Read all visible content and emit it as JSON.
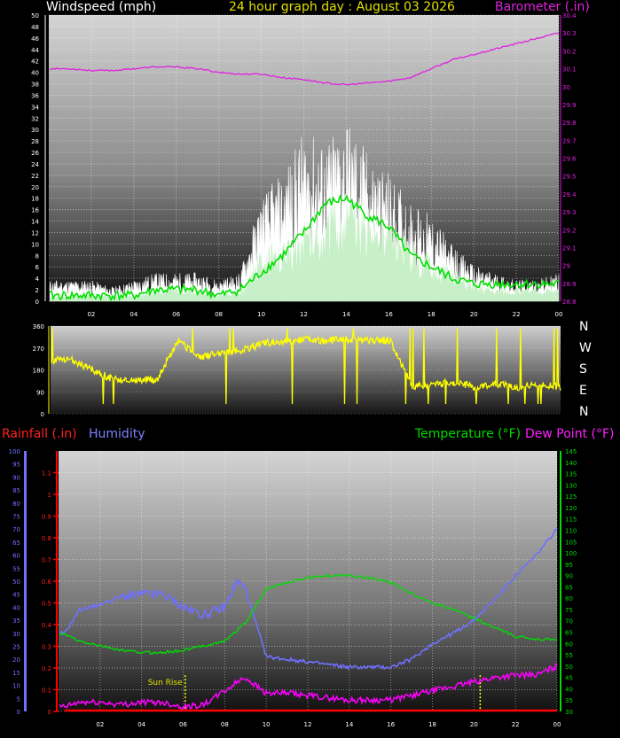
{
  "header": {
    "windspeed_title": "Windspeed (mph)",
    "graph_title": "24 hour graph day : August 03 2026",
    "barometer_title": "Barometer (.in)"
  },
  "lower_legend": {
    "rainfall": "Rainfall (.in)",
    "humidity": "Humidity",
    "temperature": "Temperature (°F)",
    "dew_point": "Dew Point (°F)"
  },
  "compass": [
    "N",
    "W",
    "S",
    "E",
    "N"
  ],
  "sunrise_label": "Sun Rise",
  "colors": {
    "wind_gust": "#ffffff",
    "wind_avg": "#c8f0c8",
    "wind_avg_line": "#00e000",
    "barometer": "#e020e0",
    "direction": "#ffff00",
    "rainfall": "#ff0000",
    "humidity": "#7070ff",
    "temperature": "#00dd00",
    "dew_point": "#ff00ff",
    "hour_marker": "#ffff00"
  },
  "chart_data": [
    {
      "type": "line",
      "panel": "wind-barometer",
      "title": "24 hour graph day : August 03 2026",
      "x_ticks": [
        "02",
        "04",
        "06",
        "08",
        "10",
        "12",
        "14",
        "16",
        "18",
        "20",
        "22",
        "00"
      ],
      "y_left_label": "Windspeed (mph)",
      "y_left_range": [
        0,
        50
      ],
      "y_left_ticks": [
        "0",
        "2",
        "4",
        "6",
        "8",
        "10",
        "12",
        "14",
        "16",
        "18",
        "20",
        "22",
        "24",
        "26",
        "28",
        "30",
        "32",
        "34",
        "36",
        "38",
        "40",
        "42",
        "44",
        "46",
        "48",
        "50"
      ],
      "y_right_label": "Barometer (.in)",
      "y_right_range": [
        28.8,
        30.4
      ],
      "y_right_ticks": [
        "28.8",
        "28.9",
        "29",
        "29.1",
        "29.2",
        "29.3",
        "29.4",
        "29.5",
        "29.6",
        "29.7",
        "29.8",
        "29.9",
        "30",
        "30.1",
        "30.2",
        "30.3",
        "30.4"
      ],
      "x": [
        1,
        2,
        3,
        4,
        5,
        6,
        7,
        8,
        9,
        10,
        11,
        12,
        13,
        14,
        15,
        16,
        17,
        18,
        19,
        20,
        21,
        22,
        23,
        24
      ],
      "series": [
        {
          "name": "wind gust",
          "values": [
            3,
            3,
            2,
            3,
            4,
            4,
            4,
            3,
            4,
            15,
            18,
            24,
            22,
            26,
            21,
            18,
            14,
            12,
            8,
            5,
            4,
            3,
            3,
            4
          ]
        },
        {
          "name": "wind average",
          "values": [
            1,
            1,
            1,
            1,
            2,
            2,
            2,
            1,
            2,
            8,
            9,
            12,
            14,
            17,
            14,
            13,
            9,
            7,
            5,
            3,
            2,
            2,
            2,
            2
          ]
        },
        {
          "name": "wind average smoothed",
          "values": [
            1,
            1,
            1,
            1,
            2,
            2,
            2,
            1,
            2,
            5,
            8,
            12,
            17,
            18,
            15,
            13,
            8,
            6,
            4,
            3,
            3,
            3,
            3,
            3
          ]
        },
        {
          "name": "barometer",
          "values": [
            30.1,
            30.09,
            30.09,
            30.1,
            30.11,
            30.11,
            30.1,
            30.08,
            30.07,
            30.07,
            30.05,
            30.04,
            30.02,
            30.01,
            30.02,
            30.03,
            30.05,
            30.1,
            30.15,
            30.18,
            30.21,
            30.24,
            30.27,
            30.3
          ]
        }
      ]
    },
    {
      "type": "line",
      "panel": "wind-direction",
      "y_range": [
        0,
        360
      ],
      "y_ticks": [
        "0",
        "90",
        "180",
        "270",
        "360"
      ],
      "x": [
        1,
        2,
        3,
        4,
        5,
        6,
        7,
        8,
        9,
        10,
        11,
        12,
        13,
        14,
        15,
        16,
        17,
        18,
        19,
        20,
        21,
        22,
        23,
        24
      ],
      "series": [
        {
          "name": "wind direction",
          "values": [
            220,
            180,
            140,
            140,
            140,
            300,
            230,
            250,
            260,
            290,
            300,
            305,
            300,
            305,
            300,
            300,
            110,
            120,
            130,
            110,
            120,
            110,
            120,
            110
          ]
        }
      ]
    },
    {
      "type": "line",
      "panel": "temperature-humidity",
      "x_ticks": [
        "02",
        "04",
        "06",
        "08",
        "10",
        "12",
        "14",
        "16",
        "18",
        "20",
        "22",
        "00"
      ],
      "y_humidity_range": [
        0,
        100
      ],
      "y_humidity_ticks": [
        "0",
        "5",
        "10",
        "15",
        "20",
        "25",
        "30",
        "35",
        "40",
        "45",
        "50",
        "55",
        "60",
        "65",
        "70",
        "75",
        "80",
        "85",
        "90",
        "95",
        "100"
      ],
      "y_rainfall_range": [
        0,
        1.2
      ],
      "y_rainfall_ticks": [
        "0",
        "0.1",
        "0.2",
        "0.3",
        "0.4",
        "0.5",
        "0.6",
        "0.7",
        "0.8",
        "0.9",
        "1",
        "1.1"
      ],
      "y_temperature_range": [
        30,
        145
      ],
      "y_temperature_ticks": [
        "30",
        "35",
        "40",
        "45",
        "50",
        "55",
        "60",
        "65",
        "70",
        "75",
        "80",
        "85",
        "90",
        "95",
        "100",
        "105",
        "110",
        "115",
        "120",
        "125",
        "130",
        "135",
        "140",
        "145"
      ],
      "x": [
        0.3,
        1,
        2,
        3,
        4,
        5,
        6,
        7,
        8,
        8.6,
        9,
        10,
        11,
        12,
        13,
        14,
        15,
        16,
        17,
        18,
        19,
        20,
        21,
        22,
        23,
        24
      ],
      "series": [
        {
          "name": "Humidity",
          "values": [
            30,
            39,
            41,
            44,
            45,
            45,
            40,
            37,
            40,
            50,
            47,
            21,
            20,
            19,
            18,
            17,
            17,
            17,
            20,
            26,
            30,
            35,
            43,
            52,
            60,
            70
          ]
        },
        {
          "name": "Temperature (°F)",
          "values": [
            64,
            61,
            59,
            57,
            56,
            56,
            57,
            59,
            61,
            66,
            69,
            84,
            87,
            89,
            90,
            90,
            89,
            87,
            82,
            78,
            75,
            71,
            67,
            63,
            62,
            62
          ]
        },
        {
          "name": "Dew Point (°F)",
          "values": [
            32,
            34,
            34,
            33,
            34,
            34,
            32,
            33,
            39,
            43,
            45,
            38,
            38,
            37,
            36,
            35,
            35,
            35,
            37,
            39,
            41,
            43,
            45,
            46,
            46,
            50
          ]
        },
        {
          "name": "Rainfall (.in)",
          "values": [
            0,
            0,
            0,
            0,
            0,
            0,
            0,
            0,
            0,
            0,
            0,
            0,
            0,
            0,
            0,
            0,
            0,
            0,
            0,
            0,
            0,
            0,
            0,
            0,
            0,
            0
          ]
        }
      ],
      "annotations": [
        "Sun Rise"
      ]
    }
  ]
}
